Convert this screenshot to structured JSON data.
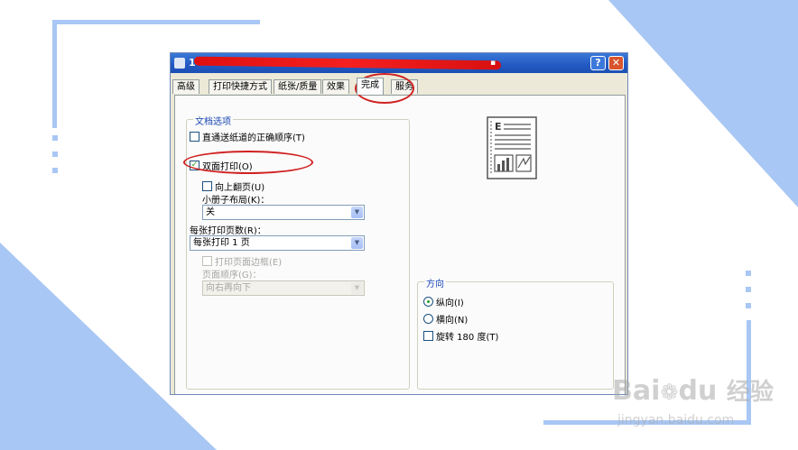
{
  "window": {
    "title_visible": "1",
    "title_mark": "▪",
    "help_label": "?",
    "close_label": "✕"
  },
  "tabs": [
    {
      "label": "高级"
    },
    {
      "label": "打印快捷方式"
    },
    {
      "label": "纸张/质量"
    },
    {
      "label": "效果"
    },
    {
      "label": "完成"
    },
    {
      "label": "服务"
    }
  ],
  "active_tab": "完成",
  "doc_options": {
    "group_title": "文档选项",
    "straight_paper_path": {
      "label": "直通送纸道的正确顺序(T)",
      "checked": false
    },
    "duplex": {
      "label": "双面打印(O)",
      "checked": true
    },
    "flip_pages_up": {
      "label": "向上翻页(U)",
      "checked": false
    },
    "booklet_label": "小册子布局(K)：",
    "booklet_value": "关",
    "pages_per_sheet_label": "每张打印页数(R)：",
    "pages_per_sheet_value": "每张打印 1 页",
    "print_page_borders": {
      "label": "打印页面边框(E)",
      "checked": false
    },
    "page_order_label": "页面顺序(G)：",
    "page_order_value": "向右再向下"
  },
  "orientation": {
    "group_title": "方向",
    "portrait": {
      "label": "纵向(I)",
      "selected": true
    },
    "landscape": {
      "label": "横向(N)",
      "selected": false
    },
    "rotate_180": {
      "label": "旋转 180 度(T)",
      "checked": false
    }
  },
  "preview": {
    "letter": "E"
  },
  "watermark": {
    "logo_left": "Bai",
    "logo_right": "du",
    "logo_cn": "经验",
    "url": "jingyan.baidu.com"
  },
  "colors": {
    "accent_blue": "#a9c7f4",
    "annotation_red": "#d02222",
    "title_redaction": "#e81515",
    "group_title": "#1a46b4"
  }
}
